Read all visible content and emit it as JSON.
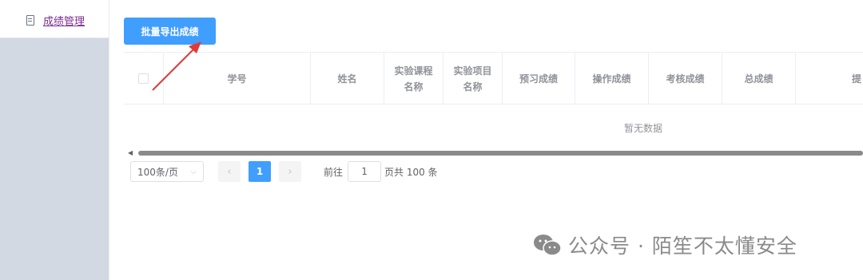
{
  "sidebar": {
    "menu_item_label": "成绩管理"
  },
  "toolbar": {
    "export_label": "批量导出成绩"
  },
  "table": {
    "headers": [
      {
        "label": "学号"
      },
      {
        "label": "姓名"
      },
      {
        "label": "实验课程\n名称"
      },
      {
        "label": "实验项目\n名称"
      },
      {
        "label": "预习成绩"
      },
      {
        "label": "操作成绩"
      },
      {
        "label": "考核成绩"
      },
      {
        "label": "总成绩"
      },
      {
        "label": "提"
      }
    ],
    "empty_text": "暂无数据"
  },
  "pagination": {
    "page_size": "100条/页",
    "current_page": "1",
    "goto_label": "前往",
    "goto_value": "1",
    "total_label": "页共 100 条"
  },
  "watermark": {
    "text": "公众号 · 陌笙不太懂安全"
  },
  "colors": {
    "primary": "#409eff",
    "annotation_arrow": "#e53935",
    "sidebar_bg": "#d3d9e3"
  }
}
